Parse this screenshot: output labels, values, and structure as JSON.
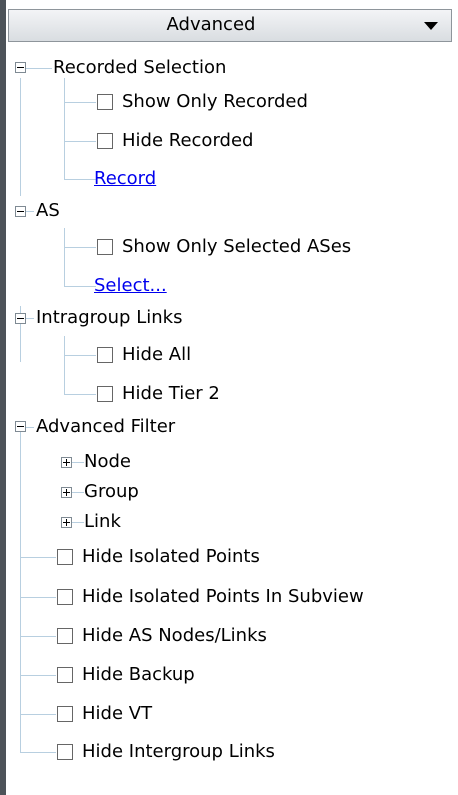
{
  "header": {
    "title": "Advanced"
  },
  "colors": {
    "link": "#0000ee",
    "tree_line": "#b8cfe0",
    "frame": "#4d5359"
  },
  "tree": {
    "recorded": {
      "title": "Recorded Selection",
      "show_only": "Show Only Recorded",
      "hide": "Hide Recorded",
      "link": "Record"
    },
    "as": {
      "title": "AS",
      "show_only": "Show Only Selected ASes",
      "link": "Select..."
    },
    "intragroup": {
      "title": "Intragroup Links",
      "hide_all": "Hide All",
      "hide_tier2": "Hide Tier 2"
    },
    "advanced_filter": {
      "title": "Advanced Filter",
      "node": "Node",
      "group": "Group",
      "link": "Link",
      "options": [
        "Hide Isolated Points",
        "Hide Isolated Points In Subview",
        "Hide AS Nodes/Links",
        "Hide Backup",
        "Hide VT",
        "Hide Intergroup Links"
      ]
    }
  }
}
